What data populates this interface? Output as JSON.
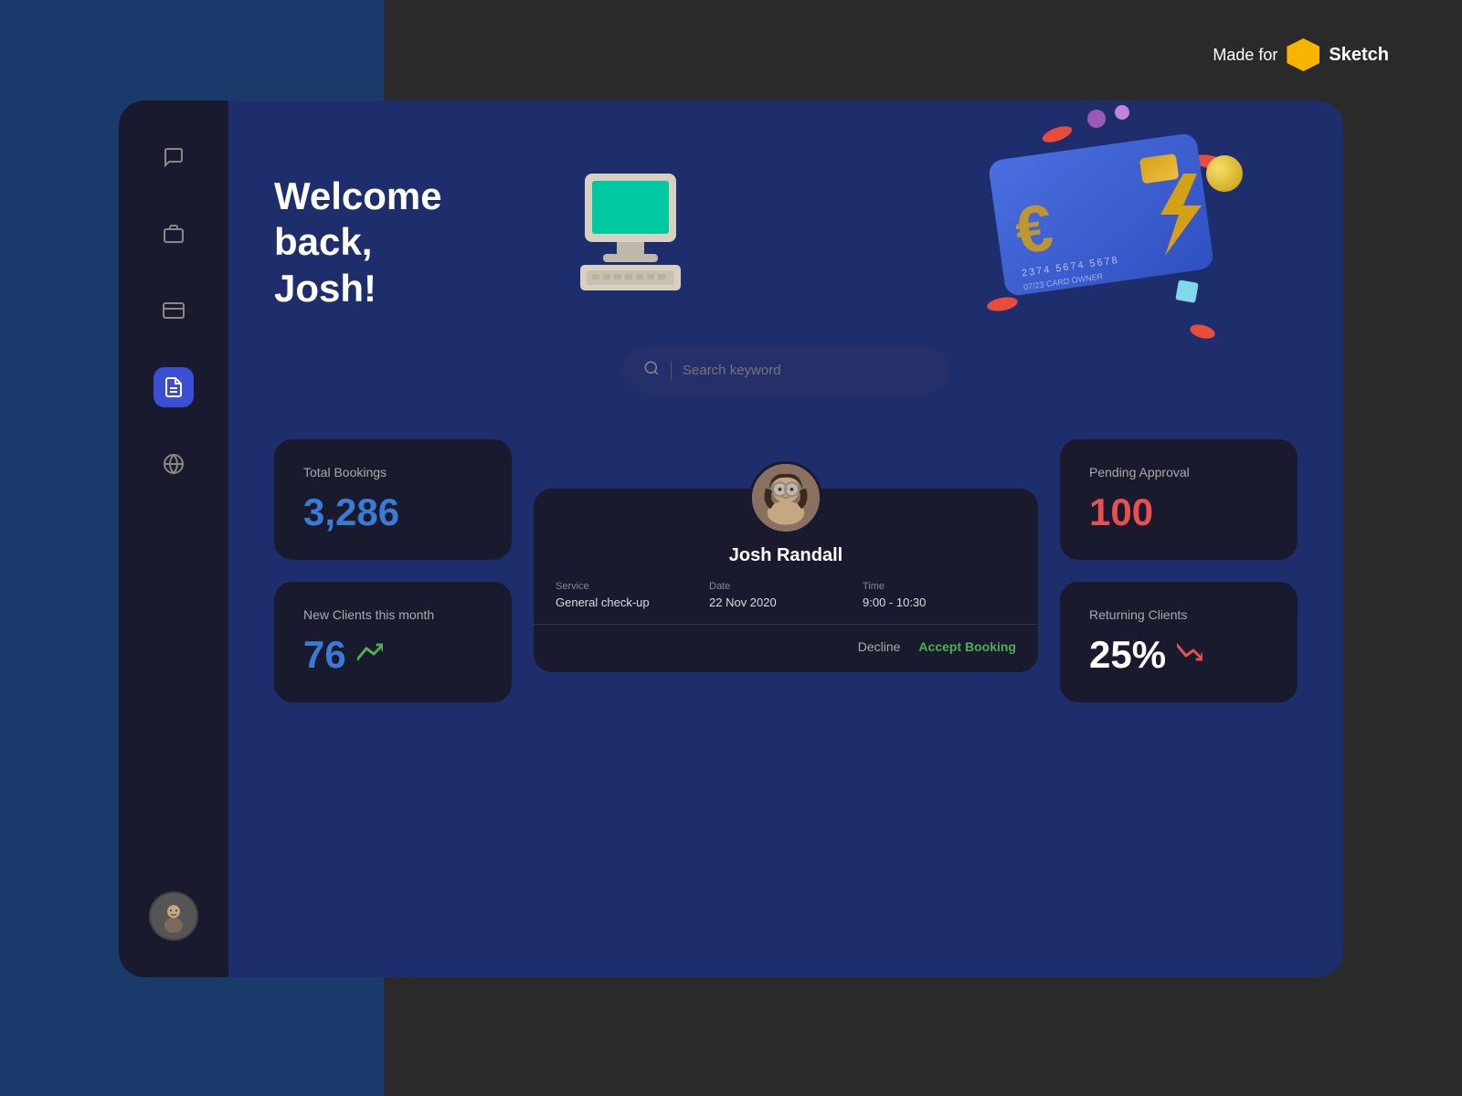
{
  "badge": {
    "made_for": "Made for",
    "sketch_label": "Sketch"
  },
  "sidebar": {
    "icons": [
      {
        "name": "chat-icon",
        "symbol": "💬",
        "active": false
      },
      {
        "name": "briefcase-icon",
        "symbol": "💼",
        "active": false
      },
      {
        "name": "card-icon",
        "symbol": "💳",
        "active": false
      },
      {
        "name": "document-icon",
        "symbol": "📄",
        "active": true
      },
      {
        "name": "globe-icon",
        "symbol": "🌐",
        "active": false
      }
    ],
    "avatar_symbol": "👤"
  },
  "header": {
    "welcome": "Welcome back,",
    "name": "Josh!"
  },
  "search": {
    "placeholder": "Search keyword"
  },
  "stats": {
    "total_bookings_label": "Total Bookings",
    "total_bookings_value": "3,286",
    "pending_approval_label": "Pending Approval",
    "pending_approval_value": "100",
    "new_clients_label": "New Clients this month",
    "new_clients_value": "76",
    "returning_clients_label": "Returning Clients",
    "returning_clients_value": "25%"
  },
  "booking": {
    "name": "Josh Randall",
    "service_label": "Service",
    "service_value": "General check-up",
    "date_label": "Date",
    "date_value": "22 Nov 2020",
    "time_label": "Time",
    "time_value": "9:00 - 10:30",
    "decline_label": "Decline",
    "accept_label": "Accept Booking"
  },
  "colors": {
    "accent_blue": "#3a7bd5",
    "accent_green": "#4caf50",
    "accent_red": "#e84f4f",
    "card_bg": "#1a1a2e",
    "main_bg": "#1e2d6b"
  }
}
